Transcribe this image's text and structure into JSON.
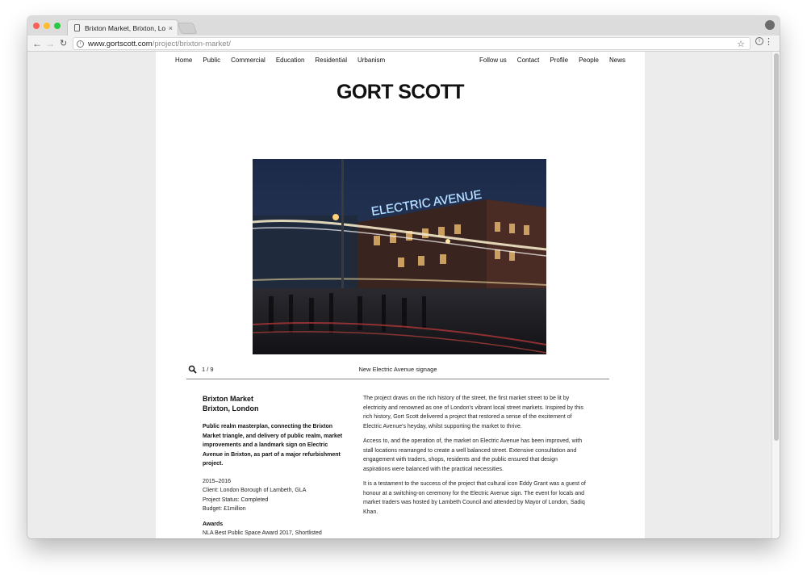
{
  "browser": {
    "tab_title": "Brixton Market, Brixton, London",
    "tab_close": "×",
    "url_host": "www.gortscott.com",
    "url_path": "/project/brixton-market/"
  },
  "site": {
    "nav_left": [
      "Home",
      "Public",
      "Commercial",
      "Education",
      "Residential",
      "Urbanism"
    ],
    "nav_right": [
      "Follow us",
      "Contact",
      "Profile",
      "People",
      "News"
    ],
    "logo": "GORT SCOTT"
  },
  "gallery": {
    "sign_text": "ELECTRIC AVENUE",
    "counter": "1 / 9",
    "caption": "New Electric Avenue signage"
  },
  "project": {
    "title_line1": "Brixton Market",
    "title_line2": "Brixton, London",
    "summary": "Public realm masterplan, connecting the Brixton Market triangle, and delivery of public realm, market improvements and a landmark sign on Electric Avenue in Brixton, as part of a major refurbishment project.",
    "years": "2015–2016",
    "client": "Client: London Borough of Lambeth, GLA",
    "status": "Project Status: Completed",
    "budget": "Budget: £1million",
    "awards_heading": "Awards",
    "awards_value": "NLA Best Public Space Award 2017, Shortlisted",
    "paragraphs": [
      "The project draws on the rich history of the street, the first market street to be lit by electricity and renowned as one of London's vibrant local street markets. Inspired by this rich history, Gort Scott delivered a project that restored a sense of the excitement of Electric Avenue's heyday, whilst supporting the market to thrive.",
      "Access to, and the operation of, the market on Electric Avenue has been improved, with stall locations rearranged to create a well balanced street. Extensive consultation and engagement with traders, shops, residents and the public ensured that design aspirations were balanced with the practical necessities.",
      "It is a testament to the success of the project that cultural icon Eddy Grant was a guest of honour at a switching-on ceremony for the Electric Avenue sign. The event for locals and market traders was hosted by Lambeth Council and attended by Mayor of London, Sadiq Khan."
    ]
  }
}
